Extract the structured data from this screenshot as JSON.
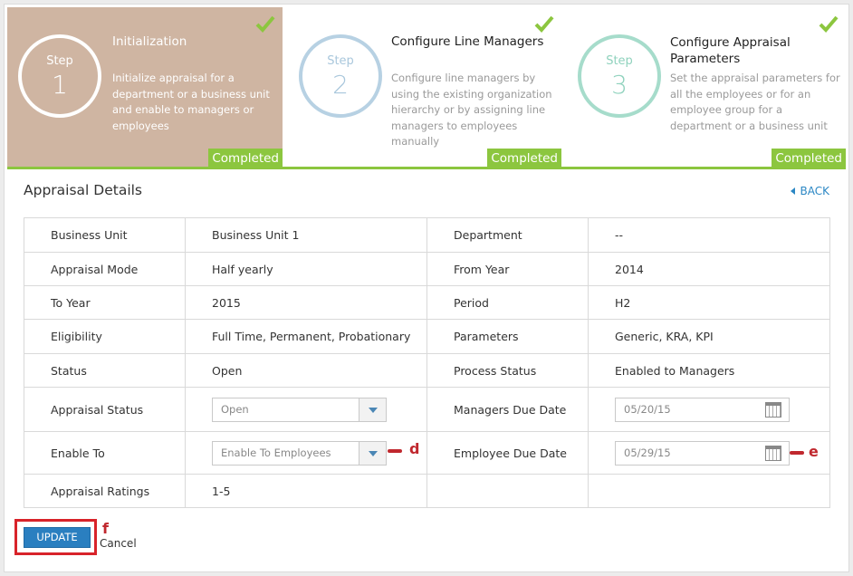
{
  "steps": [
    {
      "step_label": "Step",
      "number": "1",
      "title": "Initialization",
      "description": "Initialize appraisal for a department or a business unit and enable to managers or employees",
      "status": "Completed"
    },
    {
      "step_label": "Step",
      "number": "2",
      "title": "Configure Line Managers",
      "description": "Configure line managers by using the existing organization hierarchy or by assigning line managers to employees manually",
      "status": "Completed"
    },
    {
      "step_label": "Step",
      "number": "3",
      "title": "Configure Appraisal Parameters",
      "description": "Set the appraisal parameters for all the employees or for an employee group for a department or a business unit",
      "status": "Completed"
    }
  ],
  "section": {
    "title": "Appraisal Details",
    "back_label": "BACK"
  },
  "details": {
    "business_unit_label": "Business Unit",
    "business_unit": "Business Unit 1",
    "department_label": "Department",
    "department": "--",
    "appraisal_mode_label": "Appraisal Mode",
    "appraisal_mode": "Half yearly",
    "from_year_label": "From Year",
    "from_year": "2014",
    "to_year_label": "To Year",
    "to_year": "2015",
    "period_label": "Period",
    "period": "H2",
    "eligibility_label": "Eligibility",
    "eligibility": "Full Time, Permanent, Probationary",
    "parameters_label": "Parameters",
    "parameters": "Generic, KRA, KPI",
    "status_label": "Status",
    "status": "Open",
    "process_status_label": "Process Status",
    "process_status": "Enabled to Managers",
    "appraisal_status_label": "Appraisal Status",
    "appraisal_status": "Open",
    "managers_due_date_label": "Managers Due Date",
    "managers_due_date": "05/20/15",
    "enable_to_label": "Enable To",
    "enable_to": "Enable To Employees",
    "employee_due_date_label": "Employee Due Date",
    "employee_due_date": "05/29/15",
    "appraisal_ratings_label": "Appraisal Ratings",
    "appraisal_ratings": "1-5"
  },
  "annotations": {
    "d": "d",
    "e": "e",
    "f": "f"
  },
  "actions": {
    "update_label": "UPDATE",
    "cancel_label": "Cancel"
  },
  "colors": {
    "accent_green": "#8cc63f",
    "step1_bg": "#cfb5a2",
    "primary_blue": "#2a7fc0",
    "annotation_red": "#c0282e"
  }
}
